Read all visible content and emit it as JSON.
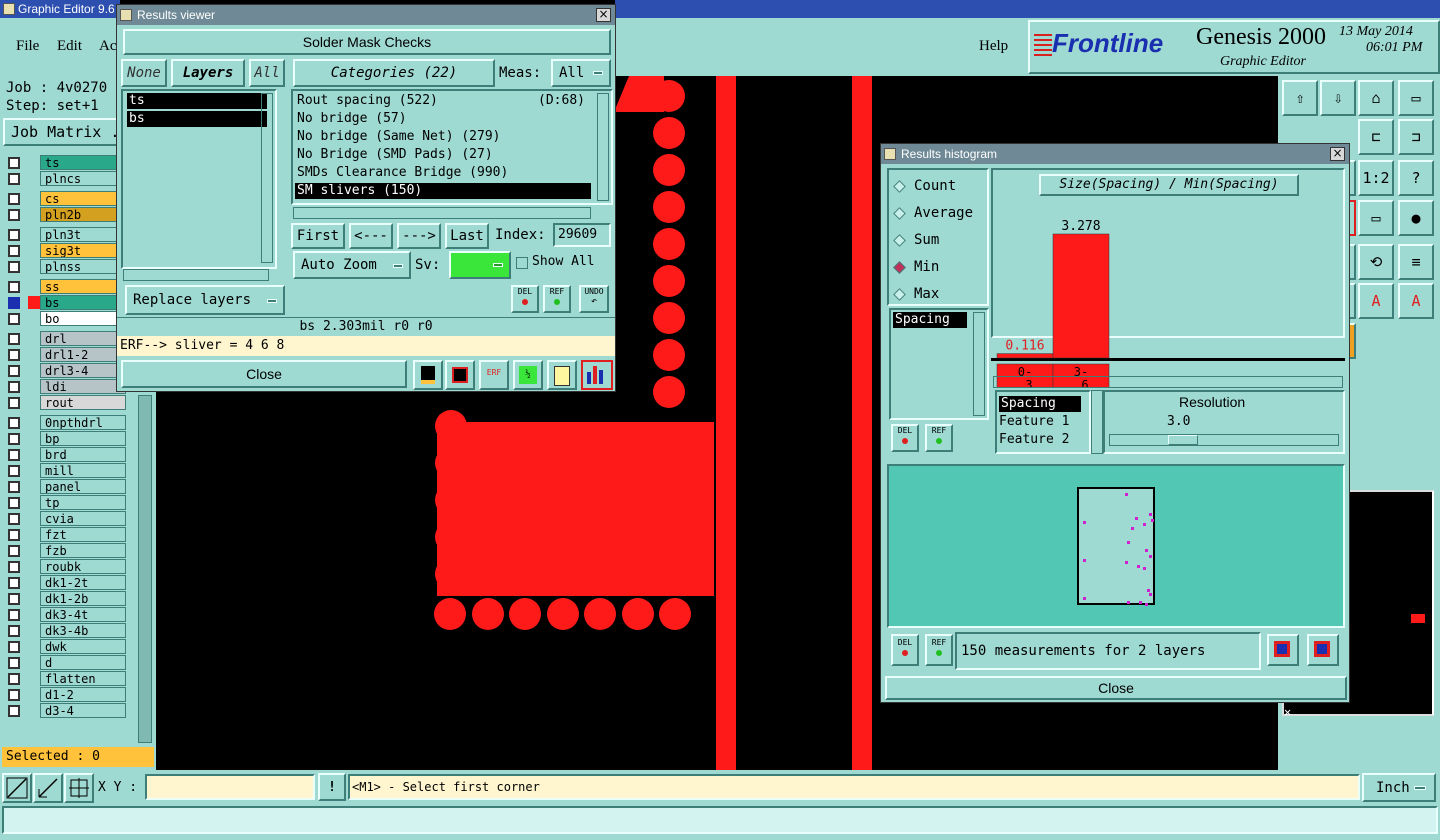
{
  "app": {
    "title": "Graphic Editor 9.6",
    "menu": [
      "File",
      "Edit",
      "Ac"
    ],
    "help_label": "Help",
    "brand": "Frontline",
    "product": "Genesis 2000",
    "product_sub": "Graphic Editor",
    "date": "13 May 2014",
    "time": "06:01 PM"
  },
  "job": {
    "job_label": "Job : 4v0270",
    "step_label": "Step: set+1",
    "matrix_label": "Job Matrix ."
  },
  "layers": [
    {
      "name": "ts",
      "color": "#2aa88a"
    },
    {
      "name": "plncs",
      "color": "#9ed9d2"
    },
    {
      "name": "cs",
      "color": "#ffc23a"
    },
    {
      "name": "pln2b",
      "color": "#d4a020"
    },
    {
      "name": "pln3t",
      "color": "#9ed9d2"
    },
    {
      "name": "sig3t",
      "color": "#ffc23a"
    },
    {
      "name": "plnss",
      "color": "#9ed9d2"
    },
    {
      "name": "ss",
      "color": "#ffc23a"
    },
    {
      "name": "bs",
      "color": "#2aa88a"
    },
    {
      "name": "bo",
      "color": "#ffffff"
    },
    {
      "name": "drl",
      "color": "#b6c4c8"
    },
    {
      "name": "drl1-2",
      "color": "#b6c4c8"
    },
    {
      "name": "drl3-4",
      "color": "#b6c4c8"
    },
    {
      "name": "ldi",
      "color": "#b6c4c8"
    },
    {
      "name": "rout",
      "color": "#d8d8d8"
    },
    {
      "name": "0npthdrl",
      "color": "#9ed9d2"
    },
    {
      "name": "bp",
      "color": "#9ed9d2"
    },
    {
      "name": "brd",
      "color": "#9ed9d2"
    },
    {
      "name": "mill",
      "color": "#9ed9d2"
    },
    {
      "name": "panel",
      "color": "#9ed9d2"
    },
    {
      "name": "tp",
      "color": "#9ed9d2"
    },
    {
      "name": "cvia",
      "color": "#9ed9d2"
    },
    {
      "name": "fzt",
      "color": "#9ed9d2"
    },
    {
      "name": "fzb",
      "color": "#9ed9d2"
    },
    {
      "name": "roubk",
      "color": "#9ed9d2"
    },
    {
      "name": "dk1-2t",
      "color": "#9ed9d2"
    },
    {
      "name": "dk1-2b",
      "color": "#9ed9d2"
    },
    {
      "name": "dk3-4t",
      "color": "#9ed9d2"
    },
    {
      "name": "dk3-4b",
      "color": "#9ed9d2"
    },
    {
      "name": "dwk",
      "color": "#9ed9d2"
    },
    {
      "name": "d",
      "color": "#9ed9d2"
    },
    {
      "name": "flatten",
      "color": "#9ed9d2"
    },
    {
      "name": "d1-2",
      "color": "#9ed9d2"
    },
    {
      "name": "d3-4",
      "color": "#9ed9d2"
    }
  ],
  "selected_label": "Selected : 0",
  "results_viewer": {
    "title": "Results viewer",
    "header": "Solder Mask Checks",
    "none_btn": "None",
    "layers_btn": "Layers",
    "all_btn": "All",
    "categories_btn": "Categories (22)",
    "meas_label": "Meas:",
    "meas_value": "All",
    "layer_list": [
      "ts",
      "bs"
    ],
    "categories": [
      {
        "label": "Rout spacing (522)",
        "extra": "(D:68)"
      },
      {
        "label": "No bridge (57)",
        "extra": ""
      },
      {
        "label": "No bridge (Same Net) (279)",
        "extra": ""
      },
      {
        "label": "No Bridge (SMD Pads) (27)",
        "extra": ""
      },
      {
        "label": "SMDs Clearance Bridge (990)",
        "extra": ""
      },
      {
        "label": "SM slivers (150)",
        "extra": ""
      }
    ],
    "first_btn": "First",
    "prev_btn": "<---",
    "next_btn": "--->",
    "last_btn": "Last",
    "index_label": "Index:",
    "index_value": "29609",
    "auto_zoom": "Auto Zoom",
    "sv_label": "Sv:",
    "show_all": "Show All",
    "replace_layers": "Replace layers",
    "del": "DEL",
    "ref": "REF",
    "undo": "UNDO",
    "status": "bs 2.303mil  r0  r0",
    "erf": "ERF--> sliver = 4 6 8",
    "close": "Close"
  },
  "histogram": {
    "title": "Results histogram",
    "modes": [
      "Count",
      "Average",
      "Sum",
      "Min",
      "Max"
    ],
    "selected_mode": "Min",
    "chart_title": "Size(Spacing) / Min(Spacing)",
    "list_item": "Spacing",
    "bins": [
      {
        "label": "0-\n3",
        "value": 0.116
      },
      {
        "label": "3-\n6",
        "value": 3.278
      }
    ],
    "value_labels": [
      "0.116",
      "3.278"
    ],
    "bin_labels_top": [
      "0-",
      "3-"
    ],
    "bin_labels_bottom": [
      "3",
      "6"
    ],
    "features": [
      "Spacing",
      "Feature 1",
      "Feature 2"
    ],
    "resolution_label": "Resolution",
    "resolution_value": "3.0",
    "measurements": "150 measurements for 2 layers",
    "del": "DEL",
    "ref": "REF",
    "close": "Close"
  },
  "bottom": {
    "xy_label": "X Y :",
    "hint": "<M1> - Select first corner",
    "units": "Inch"
  },
  "colors": {
    "teal": "#9ed9d2",
    "copper": "#ff1a1a",
    "canvas": "#000000"
  }
}
